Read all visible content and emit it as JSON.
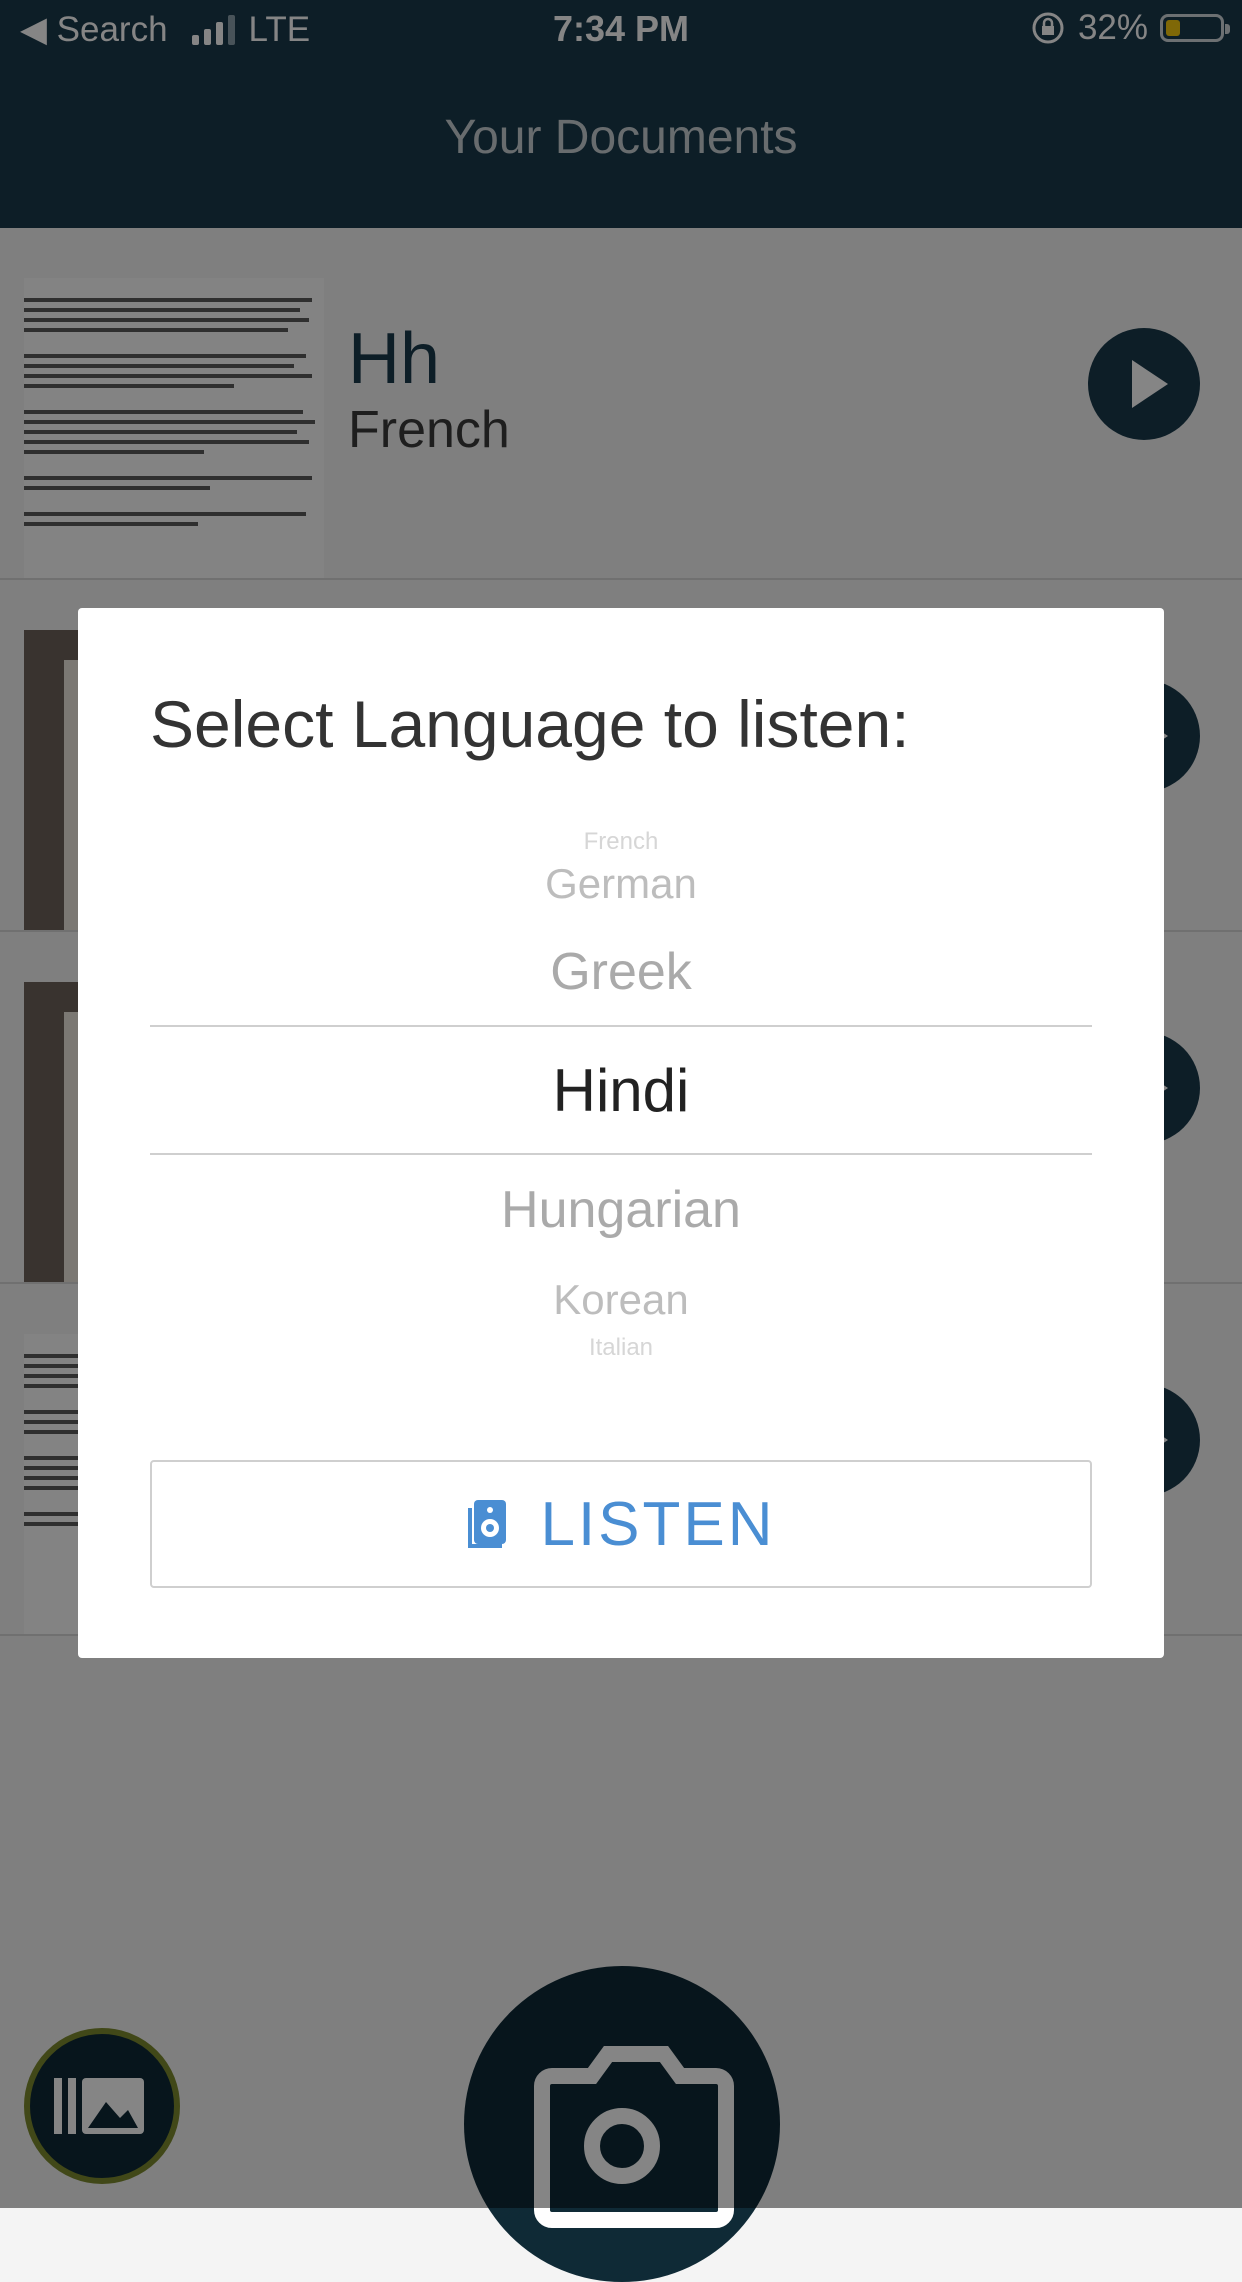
{
  "status_bar": {
    "back_label": "◀ Search",
    "carrier": "LTE",
    "time": "7:34 PM",
    "battery_percent": "32%",
    "battery_level": 0.32
  },
  "header": {
    "title": "Your Documents"
  },
  "documents": [
    {
      "title": "Hh",
      "language": "French"
    }
  ],
  "modal": {
    "title": "Select Language to listen:",
    "options": [
      "French",
      "German",
      "Greek",
      "Hindi",
      "Hungarian",
      "Korean",
      "Italian"
    ],
    "selected": "Hindi",
    "listen_label": "LISTEN"
  },
  "colors": {
    "header_bg": "#1a3a4c",
    "accent": "#4a8ed3",
    "battery": "#f3c80f"
  },
  "icons": {
    "play": "play-icon",
    "listen": "speaker-icon",
    "gallery": "gallery-icon",
    "camera": "camera-icon"
  }
}
